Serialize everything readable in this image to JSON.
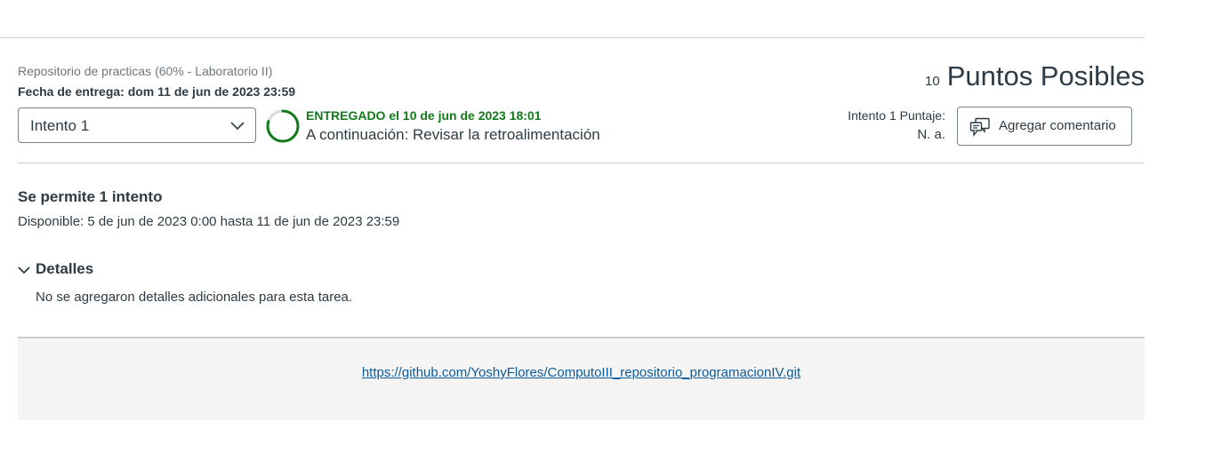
{
  "header": {
    "breadcrumb": "Repositorio de practicas (60% - Laboratorio II)",
    "due_date": "Fecha de entrega: dom 11 de jun de 2023 23:59",
    "points_value": "10",
    "points_label": "Puntos Posibles"
  },
  "attempt": {
    "selected": "Intento 1",
    "status_submitted": "ENTREGADO el 10 de jun de 2023 18:01",
    "status_next": "A continuación: Revisar la retroalimentación",
    "progress": 0.8,
    "score_label": "Intento 1 Puntaje:",
    "score_value": "N. a.",
    "comment_button": "Agregar comentario"
  },
  "info": {
    "attempts_allowed": "Se permite 1 intento",
    "availability": "Disponible: 5 de jun de 2023 0:00 hasta 11 de jun de 2023 23:59"
  },
  "details": {
    "toggle_label": "Detalles",
    "body": "No se agregaron detalles adicionales para esta tarea."
  },
  "submission": {
    "link": "https://github.com/YoshyFlores/ComputoIII_repositorio_programacionIV.git"
  },
  "colors": {
    "success": "#127a1b",
    "link": "#0b5b9b",
    "text": "#2d3b45",
    "border": "#c7cdd1"
  },
  "icons": {
    "select_chevron": "chevron-down-icon",
    "progress": "progress-ring-icon",
    "comment": "comment-bubbles-icon",
    "details_chevron": "chevron-down-icon"
  }
}
